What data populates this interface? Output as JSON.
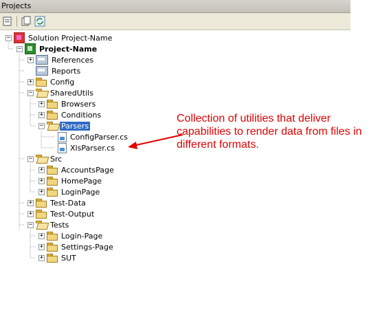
{
  "panel": {
    "title": "Projects"
  },
  "toolbar": {
    "buttons": [
      "properties-icon",
      "show-all-files-icon",
      "refresh-icon"
    ]
  },
  "tree": {
    "solution": "Solution Project-Name",
    "project": "Project-Name",
    "references": "References",
    "reports": "Reports",
    "config": "Config",
    "shared_utils": "SharedUtils",
    "browsers": "Browsers",
    "conditions": "Conditions",
    "parsers": "Parsers",
    "config_parser": "ConfigParser.cs",
    "xls_parser": "XlsParser.cs",
    "src": "Src",
    "accounts_page": "AccountsPage",
    "home_page": "HomePage",
    "login_page": "LoginPage",
    "test_data": "Test-Data",
    "test_output": "Test-Output",
    "tests": "Tests",
    "tests_login_page": "Login-Page",
    "settings_page": "Settings-Page",
    "sut": "SUT"
  },
  "annotation": {
    "text": "Collection of utilities that deliver capabilities to render data from files in different formats."
  },
  "colors": {
    "annotation": "#e00000",
    "selection": "#316ac5"
  }
}
